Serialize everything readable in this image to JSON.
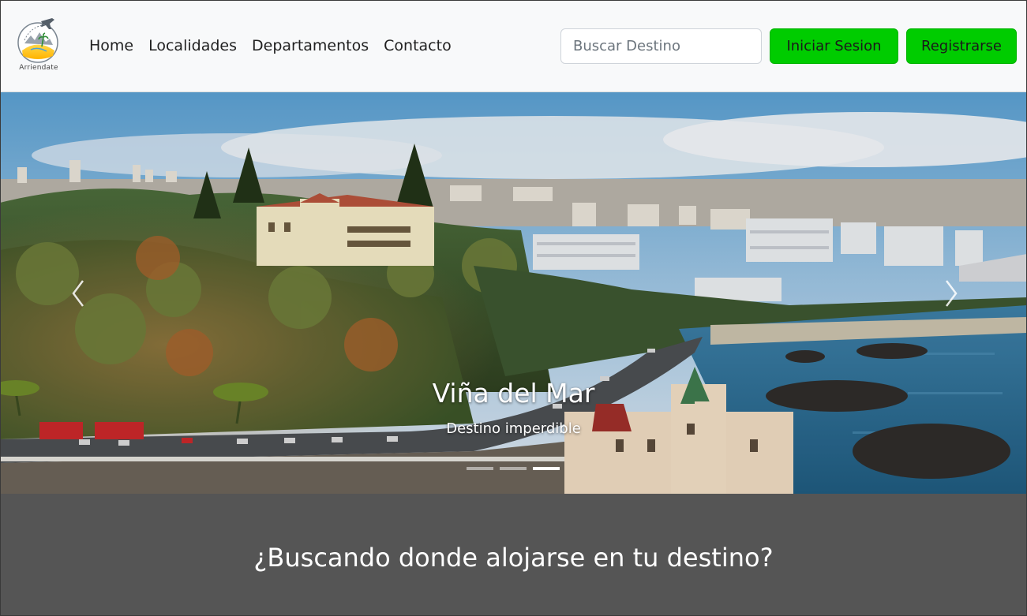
{
  "brand": {
    "logo_text": "Arriendate"
  },
  "nav": {
    "links": [
      "Home",
      "Localidades",
      "Departamentos",
      "Contacto"
    ]
  },
  "search": {
    "placeholder": "Buscar Destino",
    "value": ""
  },
  "auth": {
    "login_label": "Iniciar Sesion",
    "register_label": "Registrarse"
  },
  "carousel": {
    "title": "Viña del Mar",
    "subtitle": "Destino imperdible",
    "slides_count": 3,
    "active_index": 2,
    "prev_icon": "chevron-left-icon",
    "next_icon": "chevron-right-icon"
  },
  "section": {
    "heading": "¿Buscando donde alojarse en tu destino?"
  },
  "colors": {
    "accent_green": "#00cc00",
    "navbar_bg": "#f8f9fa",
    "band_bg": "#555555"
  }
}
